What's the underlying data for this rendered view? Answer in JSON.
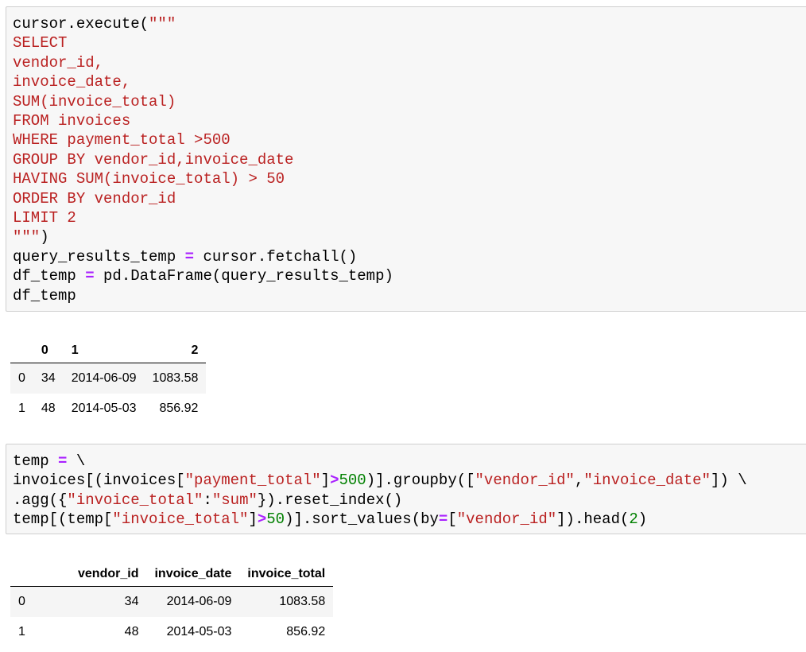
{
  "cell1": {
    "lines": [
      [
        {
          "t": "cursor.execute("
        },
        {
          "t": "\"\"\"",
          "c": "str"
        }
      ],
      [
        {
          "t": "SELECT",
          "c": "sql"
        }
      ],
      [
        {
          "t": "vendor_id,",
          "c": "sql"
        }
      ],
      [
        {
          "t": "invoice_date,",
          "c": "sql"
        }
      ],
      [
        {
          "t": "SUM(invoice_total)",
          "c": "sql"
        }
      ],
      [
        {
          "t": "FROM invoices",
          "c": "sql"
        }
      ],
      [
        {
          "t": "WHERE payment_total >500",
          "c": "sql"
        }
      ],
      [
        {
          "t": "GROUP BY vendor_id,invoice_date",
          "c": "sql"
        }
      ],
      [
        {
          "t": "HAVING SUM(invoice_total) > 50",
          "c": "sql"
        }
      ],
      [
        {
          "t": "ORDER BY vendor_id",
          "c": "sql"
        }
      ],
      [
        {
          "t": "LIMIT 2",
          "c": "sql"
        }
      ],
      [
        {
          "t": "\"\"\"",
          "c": "str"
        },
        {
          "t": ")"
        }
      ],
      [
        {
          "t": "query_results_temp "
        },
        {
          "t": "=",
          "c": "op"
        },
        {
          "t": " cursor.fetchall()"
        }
      ],
      [
        {
          "t": "df_temp "
        },
        {
          "t": "=",
          "c": "op"
        },
        {
          "t": " pd.DataFrame(query_results_temp)"
        }
      ],
      [
        {
          "t": "df_temp"
        }
      ]
    ]
  },
  "table1": {
    "columns": [
      "",
      "0",
      "1",
      "2"
    ],
    "rows": [
      [
        "0",
        "34",
        "2014-06-09",
        "1083.58"
      ],
      [
        "1",
        "48",
        "2014-05-03",
        "856.92"
      ]
    ]
  },
  "cell2": {
    "lines": [
      [
        {
          "t": "temp "
        },
        {
          "t": "=",
          "c": "op"
        },
        {
          "t": " \\"
        }
      ],
      [
        {
          "t": "invoices[(invoices["
        },
        {
          "t": "\"payment_total\"",
          "c": "str"
        },
        {
          "t": "]"
        },
        {
          "t": ">",
          "c": "op"
        },
        {
          "t": "500",
          "c": "num"
        },
        {
          "t": ")].groupby(["
        },
        {
          "t": "\"vendor_id\"",
          "c": "str"
        },
        {
          "t": ","
        },
        {
          "t": "\"invoice_date\"",
          "c": "str"
        },
        {
          "t": "]) \\"
        }
      ],
      [
        {
          "t": ".agg({"
        },
        {
          "t": "\"invoice_total\"",
          "c": "str"
        },
        {
          "t": ":"
        },
        {
          "t": "\"sum\"",
          "c": "str"
        },
        {
          "t": "}).reset_index()"
        }
      ],
      [
        {
          "t": "temp[(temp["
        },
        {
          "t": "\"invoice_total\"",
          "c": "str"
        },
        {
          "t": "]"
        },
        {
          "t": ">",
          "c": "op"
        },
        {
          "t": "50",
          "c": "num"
        },
        {
          "t": ")].sort_values(by"
        },
        {
          "t": "=",
          "c": "op"
        },
        {
          "t": "["
        },
        {
          "t": "\"vendor_id\"",
          "c": "str"
        },
        {
          "t": "]).head("
        },
        {
          "t": "2",
          "c": "num"
        },
        {
          "t": ")"
        }
      ]
    ]
  },
  "table2": {
    "columns": [
      "",
      "vendor_id",
      "invoice_date",
      "invoice_total"
    ],
    "rows": [
      [
        "0",
        "34",
        "2014-06-09",
        "1083.58"
      ],
      [
        "1",
        "48",
        "2014-05-03",
        "856.92"
      ]
    ]
  },
  "colors": {
    "string": "#ba2121",
    "operator": "#aa22ff",
    "number": "#008000",
    "cell_background": "#f7f7f7"
  }
}
